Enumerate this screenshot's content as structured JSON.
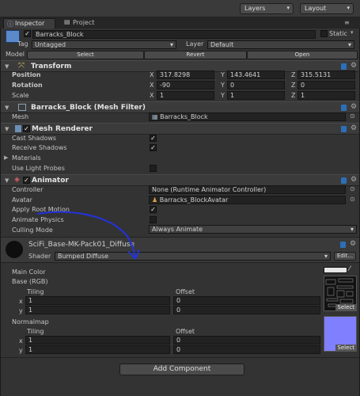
{
  "toolbar": {
    "layers_label": "Layers",
    "layout_label": "Layout"
  },
  "tabs": [
    {
      "label": "Inspector"
    },
    {
      "label": "Project"
    }
  ],
  "object": {
    "name": "Barracks_Block",
    "static_label": "Static",
    "tag_label": "Tag",
    "tag_value": "Untagged",
    "layer_label": "Layer",
    "layer_value": "Default",
    "model_label": "Model",
    "select_label": "Select",
    "revert_label": "Revert",
    "open_label": "Open"
  },
  "transform": {
    "title": "Transform",
    "position_label": "Position",
    "rotation_label": "Rotation",
    "scale_label": "Scale",
    "axis_x": "X",
    "axis_y": "Y",
    "axis_z": "Z",
    "position": {
      "x": "317.8298",
      "y": "143.4641",
      "z": "315.5131"
    },
    "rotation": {
      "x": "-90",
      "y": "0",
      "z": "0"
    },
    "scale": {
      "x": "1",
      "y": "1",
      "z": "1"
    }
  },
  "mesh_filter": {
    "title": "Barracks_Block (Mesh Filter)",
    "mesh_label": "Mesh",
    "mesh_value": "Barracks_Block"
  },
  "mesh_renderer": {
    "title": "Mesh Renderer",
    "cast_shadows_label": "Cast Shadows",
    "receive_shadows_label": "Receive Shadows",
    "materials_label": "Materials",
    "light_probes_label": "Use Light Probes",
    "cast_shadows_mark": "✓",
    "receive_shadows_mark": "✓"
  },
  "animator": {
    "title": "Animator",
    "controller_label": "Controller",
    "controller_value": "None (Runtime Animator Controller)",
    "avatar_label": "Avatar",
    "avatar_value": "Barracks_BlockAvatar",
    "root_motion_label": "Apply Root Motion",
    "root_motion_mark": "✓",
    "animate_physics_label": "Animate Physics",
    "culling_label": "Culling Mode",
    "culling_value": "Always Animate"
  },
  "material": {
    "name": "SciFi_Base-MK-Pack01_Diffuse",
    "shader_label": "Shader",
    "shader_value": "Bumped Diffuse",
    "edit_label": "Edit...",
    "main_color_label": "Main Color",
    "base_label": "Base (RGB)",
    "normalmap_label": "Normalmap",
    "tiling_label": "Tiling",
    "offset_label": "Offset",
    "x_label": "x",
    "y_label": "y",
    "base_tiling": {
      "x": "1",
      "y": "1"
    },
    "base_offset": {
      "x": "0",
      "y": "0"
    },
    "normal_tiling": {
      "x": "1",
      "y": "1"
    },
    "normal_offset": {
      "x": "0",
      "y": "0"
    },
    "select_label": "Select",
    "colors": {
      "main_color": "#e6e6e6",
      "normal_map": "#8080ff"
    }
  },
  "add_component_label": "Add Component"
}
